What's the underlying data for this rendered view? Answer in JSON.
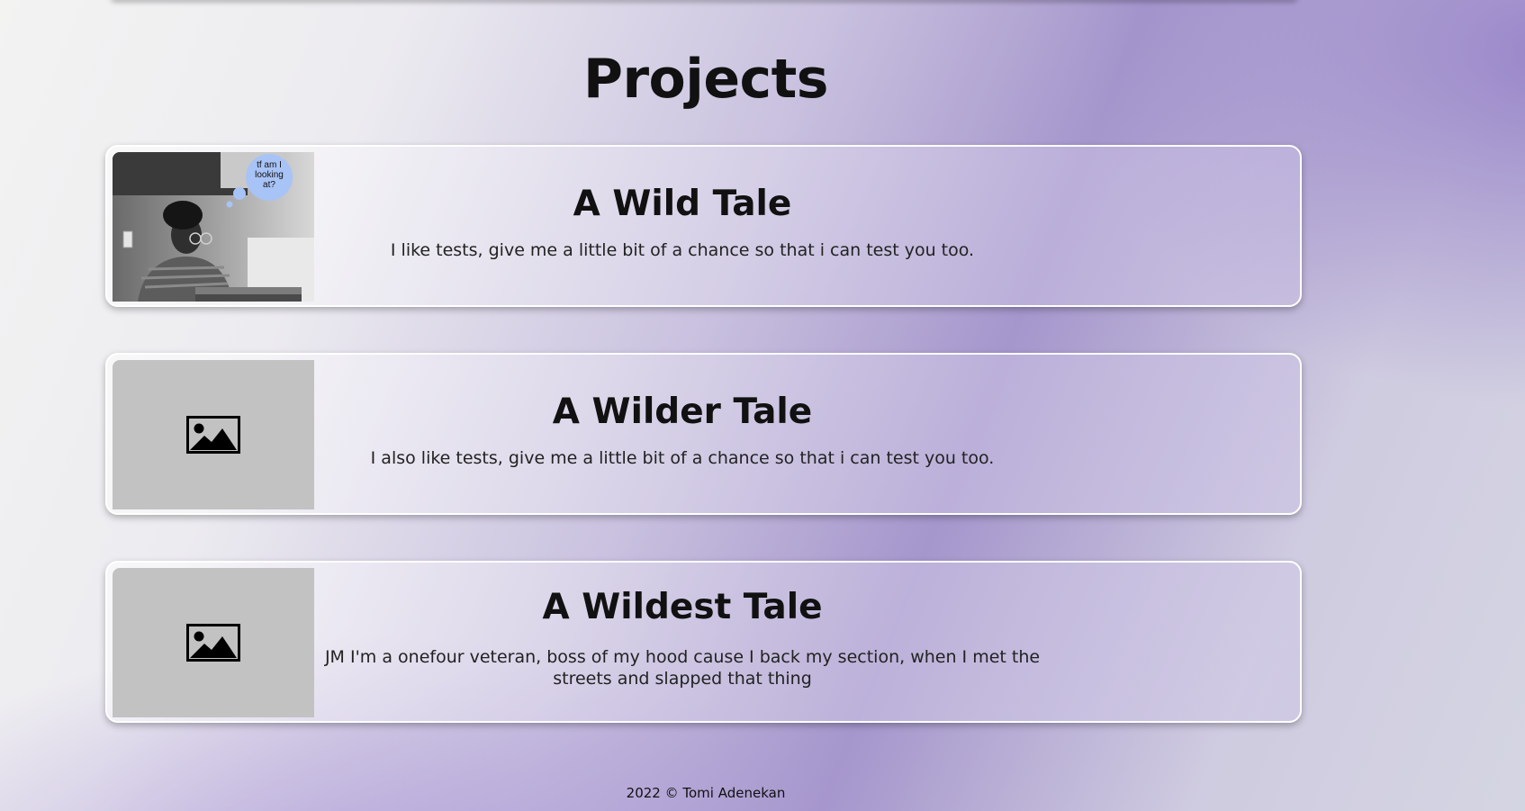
{
  "page": {
    "section_title": "Projects",
    "footer": "2022 © Tomi Adenekan"
  },
  "projects": [
    {
      "title": "A Wild Tale",
      "description": "I like tests, give me a little bit of a chance so that i can test you too.",
      "thumbnail": {
        "type": "photo",
        "subject": "person at laptop with thought bubble",
        "bubble_text": "tf am I looking at?"
      }
    },
    {
      "title": "A Wilder Tale",
      "description": "I also like tests, give me a little bit of a chance so that i can test you too.",
      "thumbnail": {
        "type": "placeholder",
        "icon": "image-placeholder-icon"
      }
    },
    {
      "title": "A Wildest Tale",
      "description": "JM I'm a onefour veteran, boss of my hood cause I back my section, when I met the streets and slapped that thing",
      "thumbnail": {
        "type": "placeholder",
        "icon": "image-placeholder-icon"
      }
    }
  ],
  "colors": {
    "card_border": "#ffffff",
    "placeholder_bg": "#c2c2c2",
    "accent_purple": "#9d8fc8"
  }
}
